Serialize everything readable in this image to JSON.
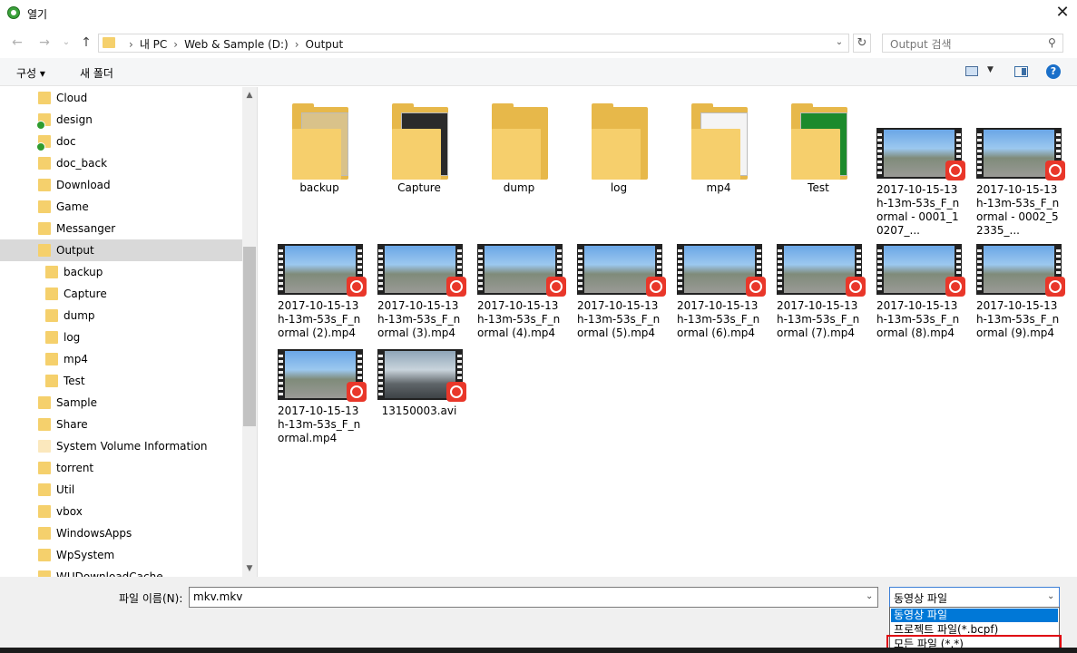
{
  "window": {
    "title": "열기",
    "close_glyph": "✕"
  },
  "nav": {
    "back": "←",
    "forward": "→",
    "recent": "⌄",
    "up": "↑"
  },
  "address": {
    "crumbs": [
      "내 PC",
      "Web & Sample (D:)",
      "Output"
    ],
    "search_placeholder": "Output 검색"
  },
  "toolbar": {
    "organize": "구성 ▾",
    "new_folder": "새 폴더",
    "help": "?"
  },
  "tree": [
    {
      "label": "Cloud",
      "indent": 0,
      "check": false
    },
    {
      "label": "design",
      "indent": 0,
      "check": true
    },
    {
      "label": "doc",
      "indent": 0,
      "check": true
    },
    {
      "label": "doc_back",
      "indent": 0,
      "check": false
    },
    {
      "label": "Download",
      "indent": 0,
      "check": false
    },
    {
      "label": "Game",
      "indent": 0,
      "check": false
    },
    {
      "label": "Messanger",
      "indent": 0,
      "check": false
    },
    {
      "label": "Output",
      "indent": 0,
      "check": false,
      "selected": true
    },
    {
      "label": "backup",
      "indent": 1,
      "check": false
    },
    {
      "label": "Capture",
      "indent": 1,
      "check": false
    },
    {
      "label": "dump",
      "indent": 1,
      "check": false
    },
    {
      "label": "log",
      "indent": 1,
      "check": false
    },
    {
      "label": "mp4",
      "indent": 1,
      "check": false
    },
    {
      "label": "Test",
      "indent": 1,
      "check": false
    },
    {
      "label": "Sample",
      "indent": 0,
      "check": false
    },
    {
      "label": "Share",
      "indent": 0,
      "check": false
    },
    {
      "label": "System Volume Information",
      "indent": 0,
      "check": false,
      "pale": true
    },
    {
      "label": "torrent",
      "indent": 0,
      "check": false
    },
    {
      "label": "Util",
      "indent": 0,
      "check": false
    },
    {
      "label": "vbox",
      "indent": 0,
      "check": false
    },
    {
      "label": "WindowsApps",
      "indent": 0,
      "check": false
    },
    {
      "label": "WpSystem",
      "indent": 0,
      "check": false
    },
    {
      "label": "WUDownloadCache",
      "indent": 0,
      "check": false
    }
  ],
  "folders": [
    {
      "name": "backup",
      "paper": "#d9c28a"
    },
    {
      "name": "Capture",
      "paper": "#2b2b2b"
    },
    {
      "name": "dump",
      "paper": ""
    },
    {
      "name": "log",
      "paper": ""
    },
    {
      "name": "mp4",
      "paper": "#f4f4f4"
    },
    {
      "name": "Test",
      "paper": "#1c8a2c"
    }
  ],
  "videos": [
    {
      "name": "2017-10-15-13h-13m-53s_F_normal - 0001_10207_..."
    },
    {
      "name": "2017-10-15-13h-13m-53s_F_normal - 0002_52335_..."
    },
    {
      "name": "2017-10-15-13h-13m-53s_F_normal (2).mp4"
    },
    {
      "name": "2017-10-15-13h-13m-53s_F_normal (3).mp4"
    },
    {
      "name": "2017-10-15-13h-13m-53s_F_normal (4).mp4"
    },
    {
      "name": "2017-10-15-13h-13m-53s_F_normal (5).mp4"
    },
    {
      "name": "2017-10-15-13h-13m-53s_F_normal (6).mp4"
    },
    {
      "name": "2017-10-15-13h-13m-53s_F_normal (7).mp4"
    },
    {
      "name": "2017-10-15-13h-13m-53s_F_normal (8).mp4"
    },
    {
      "name": "2017-10-15-13h-13m-53s_F_normal (9).mp4"
    },
    {
      "name": "2017-10-15-13h-13m-53s_F_normal.mp4"
    },
    {
      "name": "13150003.avi"
    }
  ],
  "bottom": {
    "filename_label": "파일 이름(N):",
    "filename_value": "mkv.mkv",
    "filetype_selected": "동영상 파일",
    "filetype_options": [
      "동영상 파일",
      "프로젝트 파일(*.bcpf)",
      "모든 파일 (*.*)"
    ]
  },
  "colors": {
    "accent": "#0078d7",
    "highlight_box": "#e0000f",
    "folder": "#f5d06c",
    "video_badge": "#e9372a"
  }
}
